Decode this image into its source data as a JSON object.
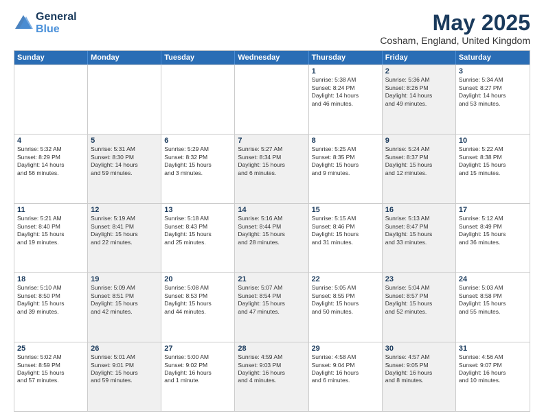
{
  "logo": {
    "line1": "General",
    "line2": "Blue"
  },
  "title": "May 2025",
  "location": "Cosham, England, United Kingdom",
  "header_days": [
    "Sunday",
    "Monday",
    "Tuesday",
    "Wednesday",
    "Thursday",
    "Friday",
    "Saturday"
  ],
  "rows": [
    [
      {
        "day": "",
        "text": "",
        "shaded": false
      },
      {
        "day": "",
        "text": "",
        "shaded": false
      },
      {
        "day": "",
        "text": "",
        "shaded": false
      },
      {
        "day": "",
        "text": "",
        "shaded": false
      },
      {
        "day": "1",
        "text": "Sunrise: 5:38 AM\nSunset: 8:24 PM\nDaylight: 14 hours\nand 46 minutes.",
        "shaded": false
      },
      {
        "day": "2",
        "text": "Sunrise: 5:36 AM\nSunset: 8:26 PM\nDaylight: 14 hours\nand 49 minutes.",
        "shaded": true
      },
      {
        "day": "3",
        "text": "Sunrise: 5:34 AM\nSunset: 8:27 PM\nDaylight: 14 hours\nand 53 minutes.",
        "shaded": false
      }
    ],
    [
      {
        "day": "4",
        "text": "Sunrise: 5:32 AM\nSunset: 8:29 PM\nDaylight: 14 hours\nand 56 minutes.",
        "shaded": false
      },
      {
        "day": "5",
        "text": "Sunrise: 5:31 AM\nSunset: 8:30 PM\nDaylight: 14 hours\nand 59 minutes.",
        "shaded": true
      },
      {
        "day": "6",
        "text": "Sunrise: 5:29 AM\nSunset: 8:32 PM\nDaylight: 15 hours\nand 3 minutes.",
        "shaded": false
      },
      {
        "day": "7",
        "text": "Sunrise: 5:27 AM\nSunset: 8:34 PM\nDaylight: 15 hours\nand 6 minutes.",
        "shaded": true
      },
      {
        "day": "8",
        "text": "Sunrise: 5:25 AM\nSunset: 8:35 PM\nDaylight: 15 hours\nand 9 minutes.",
        "shaded": false
      },
      {
        "day": "9",
        "text": "Sunrise: 5:24 AM\nSunset: 8:37 PM\nDaylight: 15 hours\nand 12 minutes.",
        "shaded": true
      },
      {
        "day": "10",
        "text": "Sunrise: 5:22 AM\nSunset: 8:38 PM\nDaylight: 15 hours\nand 15 minutes.",
        "shaded": false
      }
    ],
    [
      {
        "day": "11",
        "text": "Sunrise: 5:21 AM\nSunset: 8:40 PM\nDaylight: 15 hours\nand 19 minutes.",
        "shaded": false
      },
      {
        "day": "12",
        "text": "Sunrise: 5:19 AM\nSunset: 8:41 PM\nDaylight: 15 hours\nand 22 minutes.",
        "shaded": true
      },
      {
        "day": "13",
        "text": "Sunrise: 5:18 AM\nSunset: 8:43 PM\nDaylight: 15 hours\nand 25 minutes.",
        "shaded": false
      },
      {
        "day": "14",
        "text": "Sunrise: 5:16 AM\nSunset: 8:44 PM\nDaylight: 15 hours\nand 28 minutes.",
        "shaded": true
      },
      {
        "day": "15",
        "text": "Sunrise: 5:15 AM\nSunset: 8:46 PM\nDaylight: 15 hours\nand 31 minutes.",
        "shaded": false
      },
      {
        "day": "16",
        "text": "Sunrise: 5:13 AM\nSunset: 8:47 PM\nDaylight: 15 hours\nand 33 minutes.",
        "shaded": true
      },
      {
        "day": "17",
        "text": "Sunrise: 5:12 AM\nSunset: 8:49 PM\nDaylight: 15 hours\nand 36 minutes.",
        "shaded": false
      }
    ],
    [
      {
        "day": "18",
        "text": "Sunrise: 5:10 AM\nSunset: 8:50 PM\nDaylight: 15 hours\nand 39 minutes.",
        "shaded": false
      },
      {
        "day": "19",
        "text": "Sunrise: 5:09 AM\nSunset: 8:51 PM\nDaylight: 15 hours\nand 42 minutes.",
        "shaded": true
      },
      {
        "day": "20",
        "text": "Sunrise: 5:08 AM\nSunset: 8:53 PM\nDaylight: 15 hours\nand 44 minutes.",
        "shaded": false
      },
      {
        "day": "21",
        "text": "Sunrise: 5:07 AM\nSunset: 8:54 PM\nDaylight: 15 hours\nand 47 minutes.",
        "shaded": true
      },
      {
        "day": "22",
        "text": "Sunrise: 5:05 AM\nSunset: 8:55 PM\nDaylight: 15 hours\nand 50 minutes.",
        "shaded": false
      },
      {
        "day": "23",
        "text": "Sunrise: 5:04 AM\nSunset: 8:57 PM\nDaylight: 15 hours\nand 52 minutes.",
        "shaded": true
      },
      {
        "day": "24",
        "text": "Sunrise: 5:03 AM\nSunset: 8:58 PM\nDaylight: 15 hours\nand 55 minutes.",
        "shaded": false
      }
    ],
    [
      {
        "day": "25",
        "text": "Sunrise: 5:02 AM\nSunset: 8:59 PM\nDaylight: 15 hours\nand 57 minutes.",
        "shaded": false
      },
      {
        "day": "26",
        "text": "Sunrise: 5:01 AM\nSunset: 9:01 PM\nDaylight: 15 hours\nand 59 minutes.",
        "shaded": true
      },
      {
        "day": "27",
        "text": "Sunrise: 5:00 AM\nSunset: 9:02 PM\nDaylight: 16 hours\nand 1 minute.",
        "shaded": false
      },
      {
        "day": "28",
        "text": "Sunrise: 4:59 AM\nSunset: 9:03 PM\nDaylight: 16 hours\nand 4 minutes.",
        "shaded": true
      },
      {
        "day": "29",
        "text": "Sunrise: 4:58 AM\nSunset: 9:04 PM\nDaylight: 16 hours\nand 6 minutes.",
        "shaded": false
      },
      {
        "day": "30",
        "text": "Sunrise: 4:57 AM\nSunset: 9:05 PM\nDaylight: 16 hours\nand 8 minutes.",
        "shaded": true
      },
      {
        "day": "31",
        "text": "Sunrise: 4:56 AM\nSunset: 9:07 PM\nDaylight: 16 hours\nand 10 minutes.",
        "shaded": false
      }
    ]
  ]
}
